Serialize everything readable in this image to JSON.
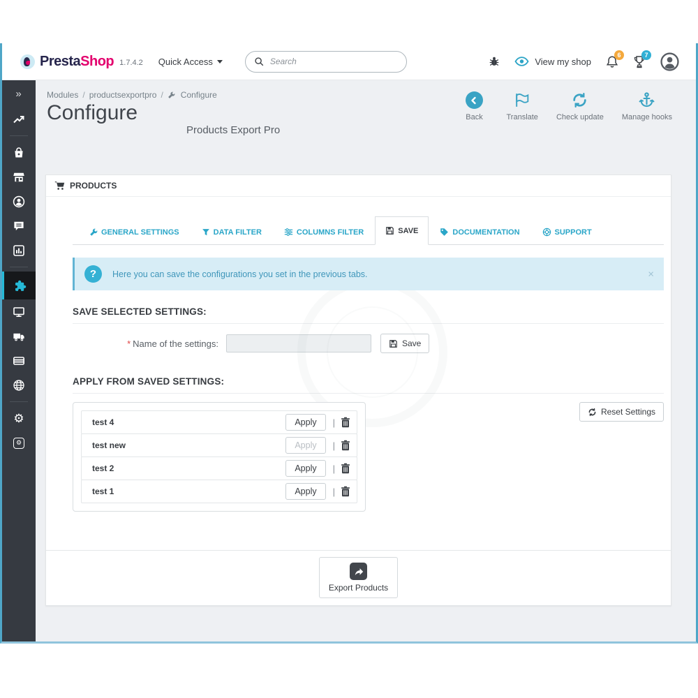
{
  "topbar": {
    "brand_presta": "Presta",
    "brand_shop": "Shop",
    "version": "1.7.4.2",
    "quick_access": "Quick Access",
    "search_placeholder": "Search",
    "view_my_shop": "View my shop",
    "notifications_count": "6",
    "achievements_count": "7"
  },
  "breadcrumb": {
    "separator": "/",
    "items": [
      "Modules",
      "productsexportpro",
      "Configure"
    ]
  },
  "page": {
    "title": "Configure",
    "subtitle": "Products Export Pro"
  },
  "toolbar": {
    "back": "Back",
    "translate": "Translate",
    "check_update": "Check update",
    "manage_hooks": "Manage hooks"
  },
  "sidebar": {
    "expand_glyph": "»",
    "gear_glyph": "⚙"
  },
  "panel": {
    "header": "PRODUCTS",
    "tabs": [
      {
        "label": "GENERAL SETTINGS"
      },
      {
        "label": "DATA FILTER"
      },
      {
        "label": "COLUMNS FILTER"
      },
      {
        "label": "SAVE",
        "active": true
      },
      {
        "label": "DOCUMENTATION"
      },
      {
        "label": "SUPPORT"
      }
    ],
    "alert": {
      "icon": "?",
      "text": "Here you can save the configurations you set in the previous tabs.",
      "close": "×"
    },
    "save_section": {
      "heading": "SAVE SELECTED SETTINGS:",
      "required_mark": "*",
      "label": "Name of the settings:",
      "input_value": "",
      "save_button": "Save"
    },
    "apply_section": {
      "heading": "APPLY FROM SAVED SETTINGS:",
      "separator": "|",
      "reset_button": "Reset Settings",
      "items": [
        {
          "name": "test 4",
          "apply": "Apply",
          "disabled": false
        },
        {
          "name": "test new",
          "apply": "Apply",
          "disabled": true
        },
        {
          "name": "test 2",
          "apply": "Apply",
          "disabled": false
        },
        {
          "name": "test 1",
          "apply": "Apply",
          "disabled": false
        }
      ]
    },
    "footer": {
      "export_button": "Export Products"
    }
  },
  "colors": {
    "accent_teal": "#25b9d7",
    "toolbar_icon_teal": "#3aa3c4",
    "sidebar_bg": "#363a41",
    "sidebar_active_bg": "#16181b",
    "alert_bg": "#d7edf6",
    "alert_text": "#3f96ba",
    "badge_orange": "#f4a93d",
    "badge_blue": "#31b0d5",
    "brand_dark": "#26254c",
    "brand_pink": "#e3006d",
    "main_bg": "#eef0f3"
  }
}
